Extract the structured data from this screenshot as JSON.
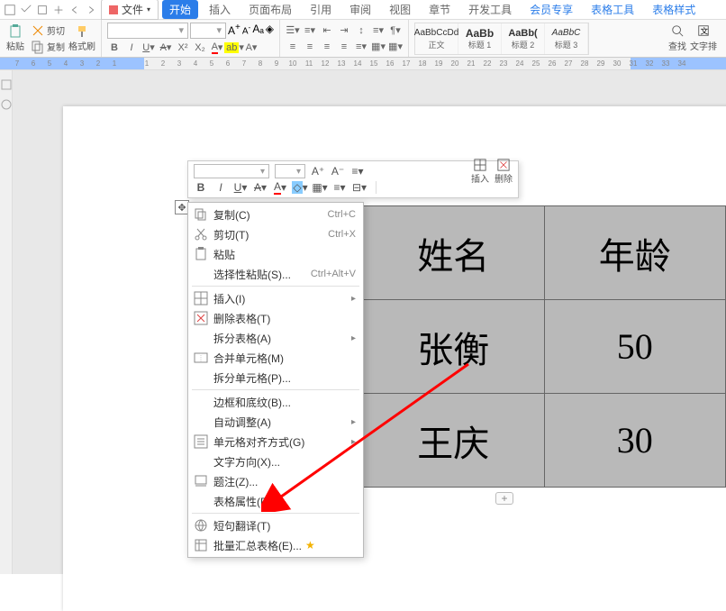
{
  "tabs": {
    "file": "文件",
    "start": "开始",
    "insert": "插入",
    "page_layout": "页面布局",
    "reference": "引用",
    "review": "审阅",
    "view": "视图",
    "section": "章节",
    "developer": "开发工具",
    "member": "会员专享",
    "table_tools": "表格工具",
    "table_style": "表格样式"
  },
  "clipboard": {
    "paste": "粘贴",
    "cut": "剪切",
    "copy": "复制",
    "format_painter": "格式刷"
  },
  "font_combo": "",
  "size_combo": "",
  "style_gallery": {
    "s1_prev": "AaBbCcDd",
    "s1_lbl": "正文",
    "s2_prev": "AaBb",
    "s2_lbl": "标题 1",
    "s3_prev": "AaBb(",
    "s3_lbl": "标题 2",
    "s4_prev": "AaBbC",
    "s4_lbl": "标题 3"
  },
  "find": {
    "find": "查找",
    "text_tool": "文字排"
  },
  "ruler_marks": [
    "7",
    "6",
    "5",
    "4",
    "3",
    "2",
    "1",
    "",
    "1",
    "2",
    "3",
    "4",
    "5",
    "6",
    "7",
    "8",
    "9",
    "10",
    "11",
    "12",
    "13",
    "14",
    "15",
    "16",
    "17",
    "18",
    "19",
    "20",
    "21",
    "22",
    "23",
    "24",
    "25",
    "26",
    "27",
    "28",
    "29",
    "30",
    "31",
    "32",
    "33",
    "34"
  ],
  "mini_toolbar": {
    "insert": "插入",
    "delete": "删除"
  },
  "context_menu": {
    "copy": "复制(C)",
    "copy_sc": "Ctrl+C",
    "cut": "剪切(T)",
    "cut_sc": "Ctrl+X",
    "paste": "粘贴",
    "paste_special": "选择性粘贴(S)...",
    "paste_special_sc": "Ctrl+Alt+V",
    "insert": "插入(I)",
    "delete_table": "删除表格(T)",
    "split_table": "拆分表格(A)",
    "merge_cells": "合并单元格(M)",
    "split_cells": "拆分单元格(P)...",
    "borders": "边框和底纹(B)...",
    "autofit": "自动调整(A)",
    "cell_align": "单元格对齐方式(G)",
    "text_dir": "文字方向(X)...",
    "caption": "题注(Z)...",
    "table_props": "表格属性(R)...",
    "trans": "短句翻译(T)",
    "summary": "批量汇总表格(E)..."
  },
  "table_cells": {
    "r1c1": "姓名",
    "r1c2": "年龄",
    "r2c1": "张衡",
    "r2c2": "50",
    "r3c1": "王庆",
    "r3c2": "30"
  },
  "add_row": "+"
}
